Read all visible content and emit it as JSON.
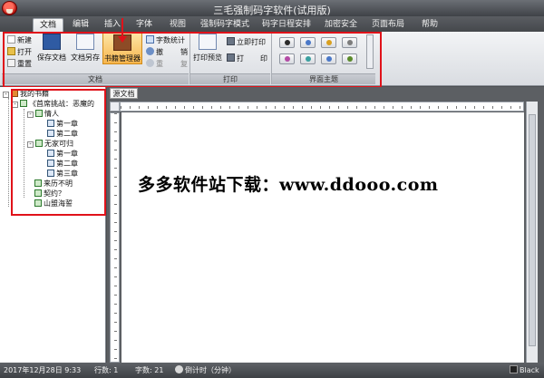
{
  "app": {
    "title": "三毛强制码字软件(试用版)"
  },
  "menu": {
    "tabs": [
      "文档",
      "编辑",
      "插入",
      "字体",
      "视图",
      "强制码字模式",
      "码字日程安排",
      "加密安全",
      "页面布局",
      "帮助"
    ],
    "active": "文档"
  },
  "ribbon": {
    "doc_group": {
      "new": "新建",
      "open": "打开",
      "reset": "重置",
      "save_doc": "保存文档",
      "save_as": "文档另存",
      "book_manager": "书籍管理器",
      "word_stats": "字数统计",
      "undo": "撤",
      "undo2": "销",
      "redo": "重",
      "redo2": "复",
      "label": "文档"
    },
    "print_group": {
      "preview": "打印预览",
      "print_now": "立即打印",
      "print": "打",
      "print2": "印",
      "label": "打印"
    },
    "theme_group": {
      "label": "界面主题",
      "colors": [
        "#2a2a2a",
        "#4a78c8",
        "#d9a020",
        "#7d7d7d",
        "#b44ba6",
        "#3aa0a0",
        "#4a78c8",
        "#5a8a2a"
      ]
    }
  },
  "tree": {
    "root": "我的书籍",
    "book1": "《首席挑战：恶魔的",
    "vol1": "情人",
    "ch1": "第一章",
    "ch2": "第二章",
    "vol2": "无家可归",
    "ch3": "第一章",
    "ch4": "第二章",
    "ch5": "第三章",
    "item1": "来历不明",
    "item2": "契约？",
    "item3": "山盟海誓"
  },
  "editor": {
    "tab": "源文档",
    "content": "多多软件站下载：www.ddooo.com",
    "watermark": "多多软件站"
  },
  "statusbar": {
    "date": "2017年12月28日 9:33",
    "lines": "行数: 1",
    "chars": "字数: 21",
    "countdown": "倒计时（分钟）",
    "theme": "Black"
  }
}
